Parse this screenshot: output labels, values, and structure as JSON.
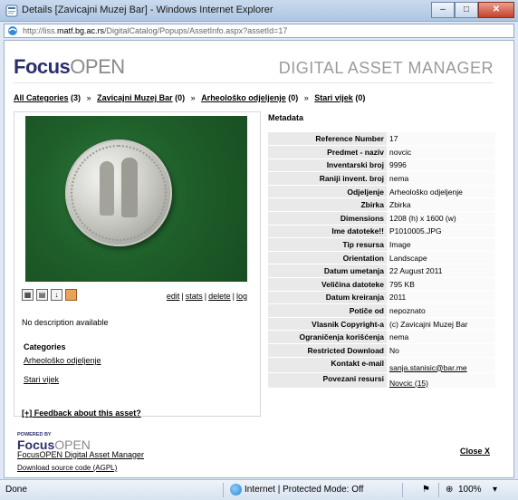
{
  "window": {
    "title": "Details [Zavicajni Muzej Bar] - Windows Internet Explorer",
    "url_prefix": "http://liss.",
    "url_host": "matf.bg.ac.rs",
    "url_path": "/DigitalCatalog/Popups/AssetInfo.aspx?assetId=17",
    "minimize": "–",
    "maximize": "□",
    "close": "✕"
  },
  "brand": {
    "focus": "Focus",
    "open": "OPEN",
    "subtitle": "DIGITAL ASSET MANAGER"
  },
  "breadcrumb": [
    {
      "label": "All Categories",
      "count": "(3)"
    },
    {
      "label": "Zavicajni Muzej Bar",
      "count": "(0)"
    },
    {
      "label": "Arheološko odjeljenje",
      "count": "(0)"
    },
    {
      "label": "Stari vijek",
      "count": "(0)"
    }
  ],
  "breadcrumb_sep": "»",
  "asset": {
    "actions": {
      "edit": "edit",
      "stats": "stats",
      "delete": "delete",
      "log": "log",
      "sep": "|"
    },
    "description": "No description available",
    "categories_title": "Categories",
    "categories": [
      "Arheološko odjeljenje",
      "Stari vijek"
    ],
    "feedback": "[+] Feedback about this asset?"
  },
  "metadata": {
    "title": "Metadata",
    "rows": [
      {
        "key": "Reference Number",
        "value": "17"
      },
      {
        "key": "Predmet - naziv",
        "value": "novcic"
      },
      {
        "key": "Inventarski broj",
        "value": "9996"
      },
      {
        "key": "Raniji invent. broj",
        "value": "nema"
      },
      {
        "key": "Odjeljenje",
        "value": "Arheološko odjeljenje"
      },
      {
        "key": "Zbirka",
        "value": "Zbirka"
      },
      {
        "key": "Dimensions",
        "value": "1208 (h) x 1600 (w)"
      },
      {
        "key": "Ime datoteke!!",
        "value": "P1010005.JPG"
      },
      {
        "key": "Tip resursa",
        "value": "Image"
      },
      {
        "key": "Orientation",
        "value": "Landscape"
      },
      {
        "key": "Datum umetanja",
        "value": "22 August 2011"
      },
      {
        "key": "Veličina datoteke",
        "value": "795 KB"
      },
      {
        "key": "Datum kreiranja",
        "value": "2011"
      },
      {
        "key": "Potiče od",
        "value": "nepoznato"
      },
      {
        "key": "Vlasnik Copyright-a",
        "value": "(c) Zavicajni Muzej Bar"
      },
      {
        "key": "Ograničenja korišćenja",
        "value": "nema"
      },
      {
        "key": "Restricted Download",
        "value": "No"
      },
      {
        "key": "Kontakt e-mail",
        "value": "sanja.stanisic@bar.me"
      },
      {
        "key": "Povezani resursi",
        "value": "Novcic (15)"
      }
    ]
  },
  "footer": {
    "powered_by": "POWERED BY",
    "focus": "Focus",
    "open": "OPEN",
    "app_link": "FocusOPEN Digital Asset Manager",
    "download_link": "Download source code (AGPL)",
    "close": "Close X"
  },
  "statusbar": {
    "status": "Done",
    "zone": "Internet | Protected Mode: Off",
    "zoom": "100%"
  },
  "icons": [
    "ie-icon",
    "page-icon",
    "grid-view-icon",
    "detail-view-icon",
    "download-icon",
    "lightbox-icon",
    "globe-icon",
    "zoom-icon"
  ]
}
